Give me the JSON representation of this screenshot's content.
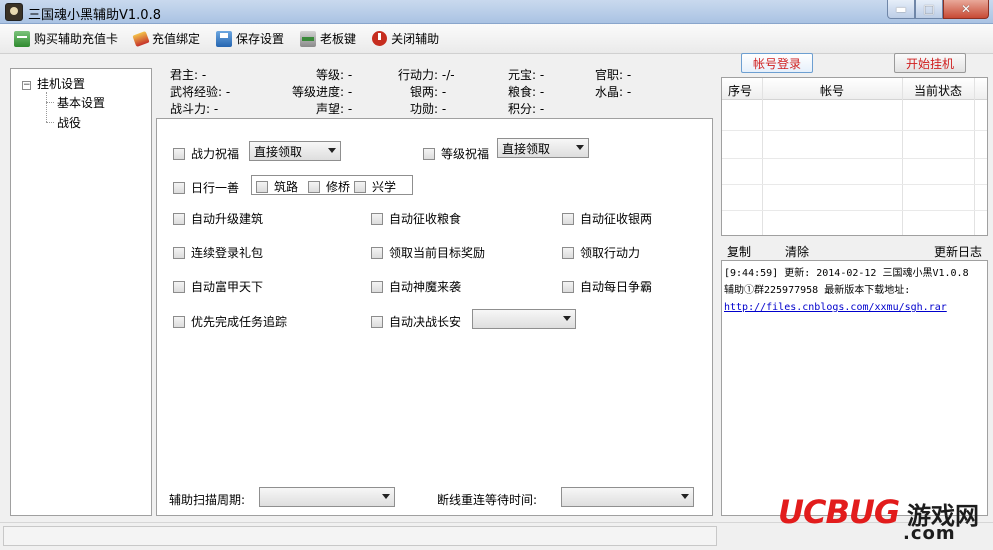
{
  "window": {
    "title": "三国魂小黑辅助V1.0.8",
    "min_glyph": "▬",
    "max_glyph": "□",
    "close_glyph": "✕"
  },
  "toolbar": {
    "buy_card": "购买辅助充值卡",
    "recharge_bind": "充值绑定",
    "save_settings": "保存设置",
    "boss_key": "老板键",
    "close_assist": "关闭辅助"
  },
  "tree": {
    "root": "挂机设置",
    "toggle": "−",
    "children": [
      "基本设置",
      "战役"
    ]
  },
  "info": {
    "lord": "君主: -",
    "level": "等级: -",
    "action_power": "行动力: -/-",
    "yuanbao": "元宝: -",
    "office": "官职: -",
    "general_exp": "武将经验: -",
    "level_progress": "等级进度: -",
    "silver": "银两: -",
    "grain": "粮食: -",
    "crystal": "水晶: -",
    "combat_power": "战斗力: -",
    "prestige": "声望: -",
    "merit": "功勋: -",
    "points": "积分: -"
  },
  "options": {
    "combat_blessing": "战力祝福",
    "combat_blessing_select": "直接领取",
    "level_blessing": "等级祝福",
    "level_blessing_select": "直接领取",
    "daily_good_deed": "日行一善",
    "build_road": "筑路",
    "repair_bridge": "修桥",
    "promote_learning": "兴学",
    "auto_upgrade_building": "自动升级建筑",
    "auto_collect_grain": "自动征收粮食",
    "auto_collect_silver": "自动征收银两",
    "login_gift": "连续登录礼包",
    "claim_target_reward": "领取当前目标奖励",
    "claim_action_power": "领取行动力",
    "auto_wealth": "自动富甲天下",
    "auto_demon_attack": "自动神魔来袭",
    "auto_daily_contest": "自动每日争霸",
    "prioritize_quest_tracking": "优先完成任务追踪",
    "auto_decisive_battle": "自动决战长安",
    "scan_cycle_label": "辅助扫描周期:",
    "reconnect_wait_label": "断线重连等待时间:"
  },
  "right": {
    "login_button": "帐号登录",
    "start_button": "开始挂机",
    "table_headers": [
      "序号",
      "帐号",
      "当前状态"
    ],
    "log_copy": "复制",
    "log_clear": "清除",
    "log_update": "更新日志",
    "log_lines": [
      "[9:44:59] 更新: 2014-02-12 三国魂小黑V1.0.8",
      "辅助①群225977958 最新版本下载地址:"
    ],
    "log_link": "http://files.cnblogs.com/xxmu/sgh.rar"
  },
  "watermark": {
    "brand": "UCBUG",
    "game_site": "游戏网",
    "domain": ".com"
  },
  "colors": {
    "accent_red": "#d01f1f",
    "link_blue": "#0000cc",
    "watermark_red": "#e21c1c"
  }
}
